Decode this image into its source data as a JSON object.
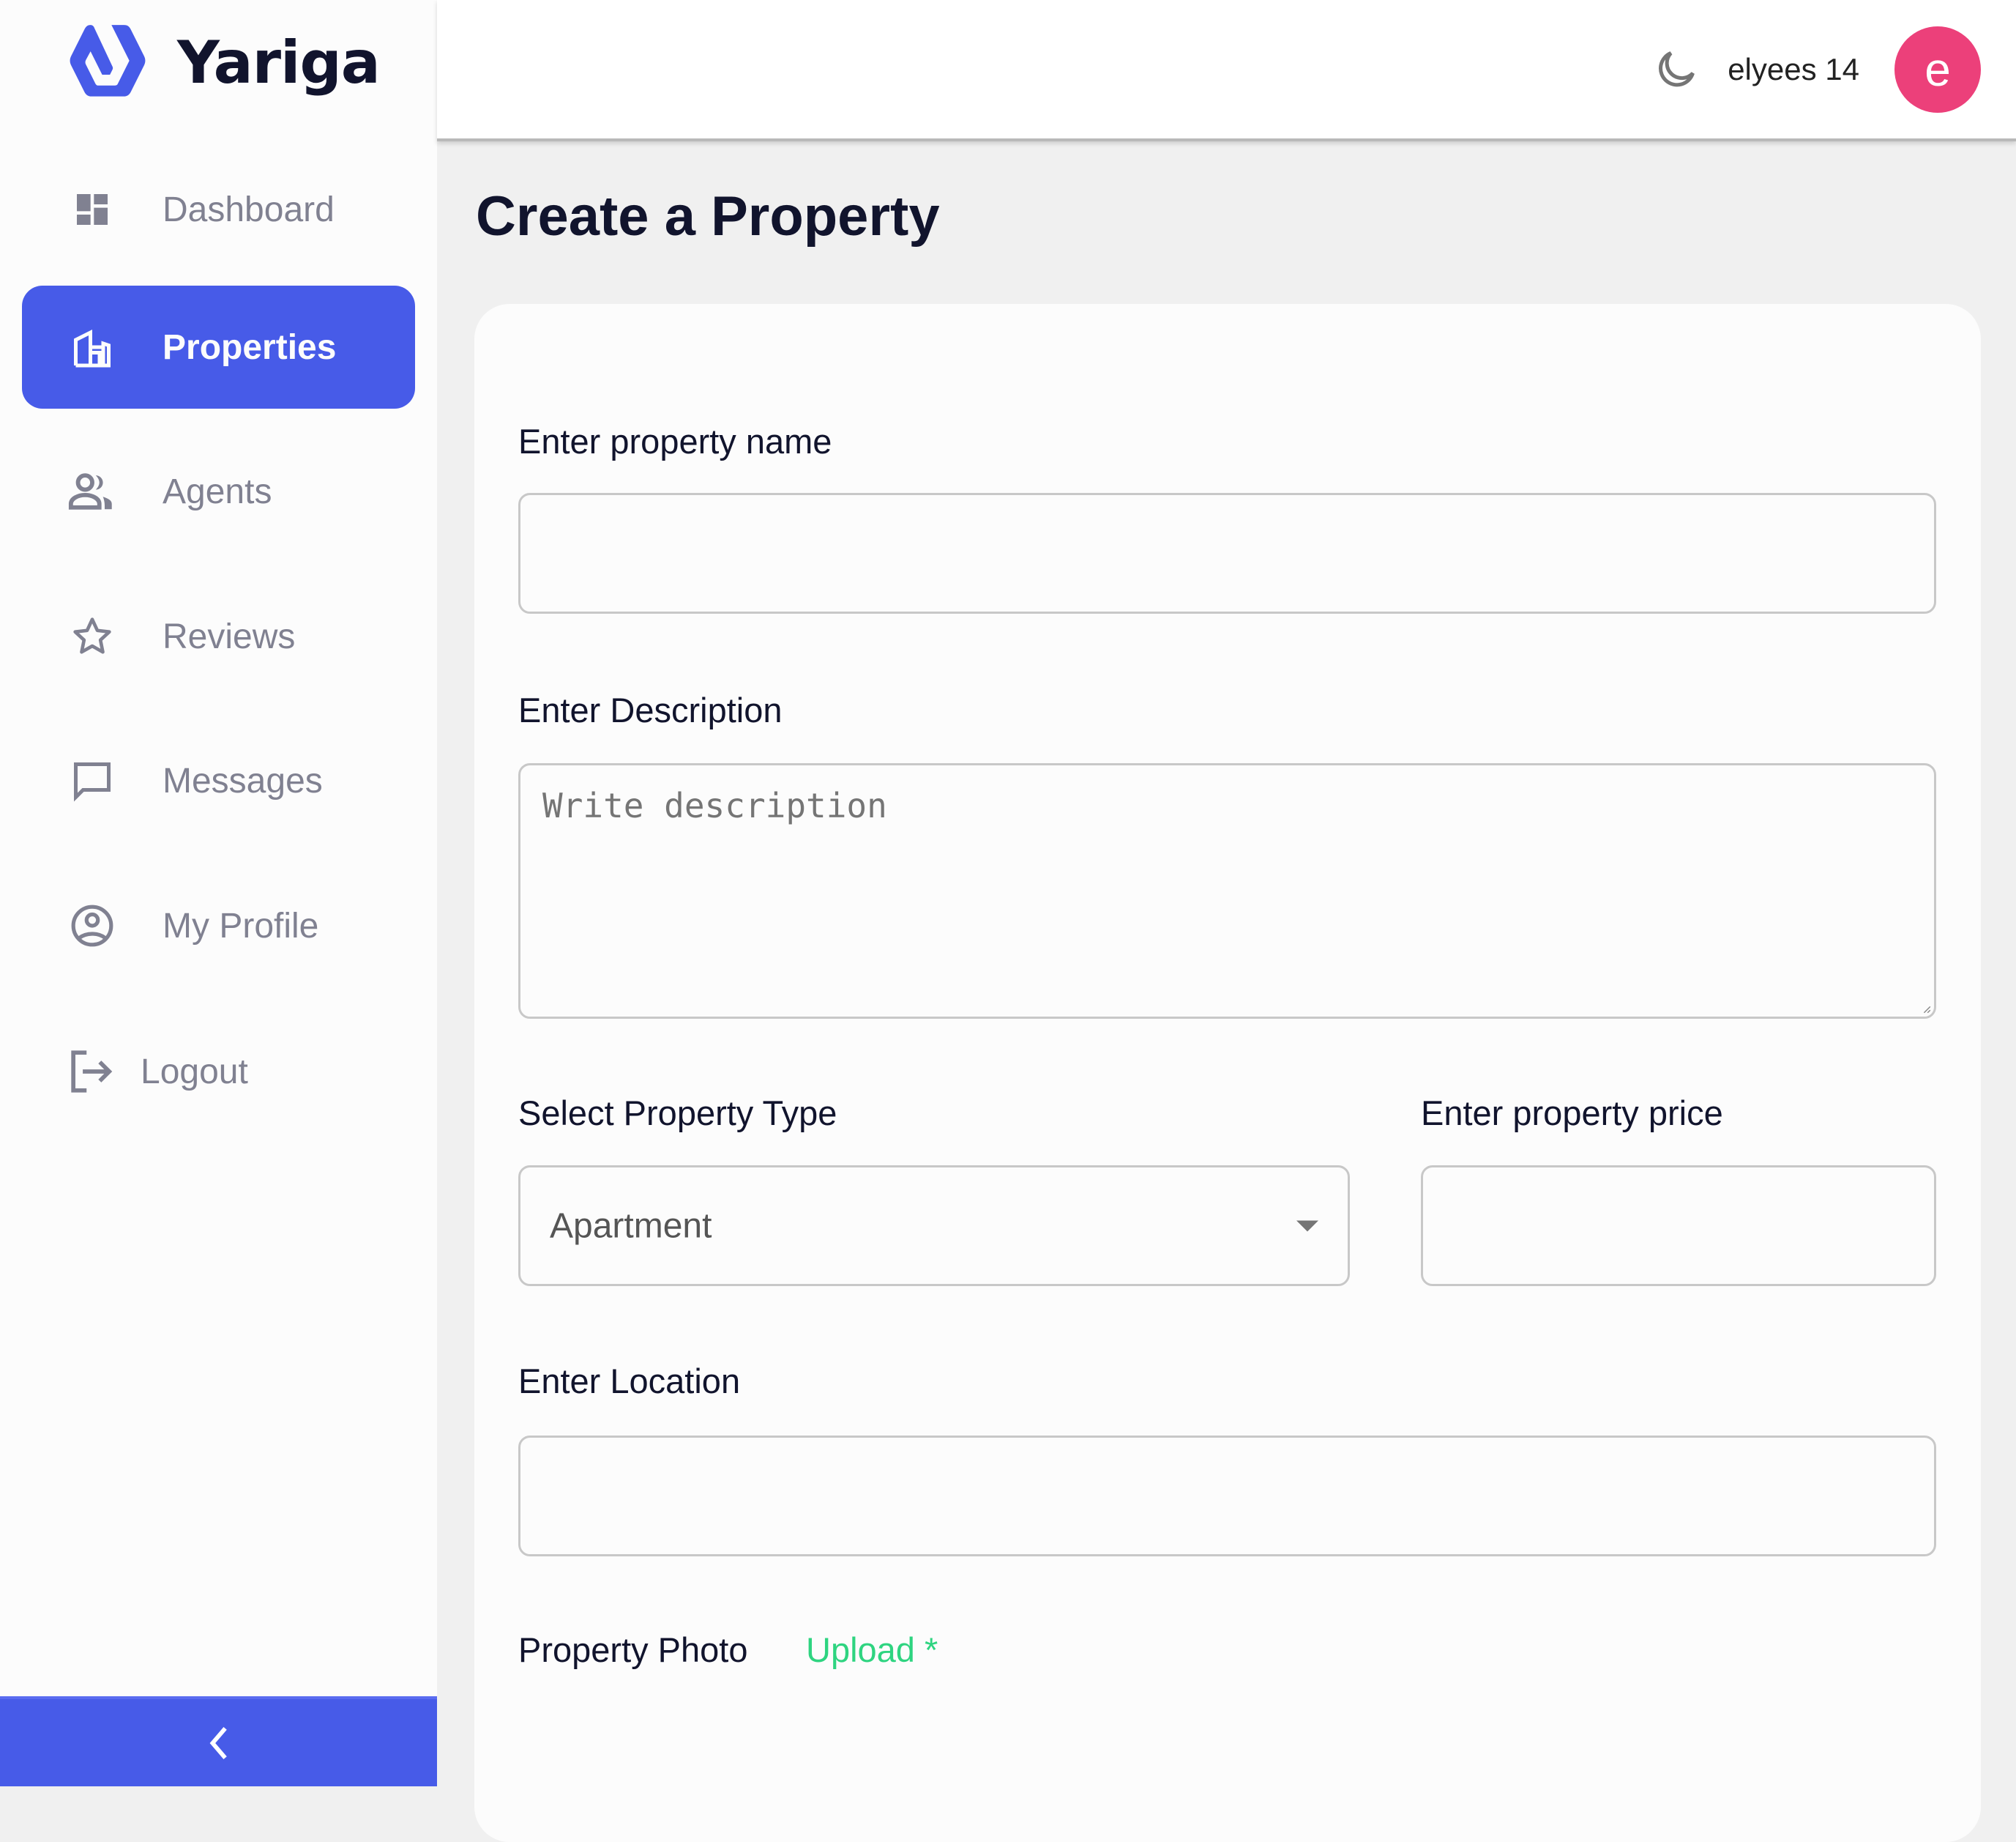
{
  "app": {
    "name": "Yariga",
    "brand_color": "#475be8"
  },
  "sidebar": {
    "items": [
      {
        "label": "Dashboard",
        "icon": "dashboard-icon",
        "active": false
      },
      {
        "label": "Properties",
        "icon": "building-icon",
        "active": true
      },
      {
        "label": "Agents",
        "icon": "people-icon",
        "active": false
      },
      {
        "label": "Reviews",
        "icon": "star-icon",
        "active": false
      },
      {
        "label": "Messages",
        "icon": "chat-icon",
        "active": false
      },
      {
        "label": "My Profile",
        "icon": "account-circle-icon",
        "active": false
      }
    ],
    "logout_label": "Logout",
    "collapse_icon": "chevron-left-icon"
  },
  "header": {
    "theme_icon": "moon-icon",
    "username": "elyees 14",
    "avatar_initial": "e",
    "avatar_color": "#ec407a"
  },
  "page": {
    "title": "Create a Property"
  },
  "form": {
    "name": {
      "label": "Enter property name",
      "value": ""
    },
    "description": {
      "label": "Enter Description",
      "placeholder": "Write description",
      "value": ""
    },
    "type": {
      "label": "Select Property Type",
      "selected": "Apartment"
    },
    "price": {
      "label": "Enter property price",
      "value": ""
    },
    "location": {
      "label": "Enter Location",
      "value": ""
    },
    "photo": {
      "label": "Property Photo",
      "upload_label": "Upload *",
      "upload_color": "#2ed480"
    }
  }
}
